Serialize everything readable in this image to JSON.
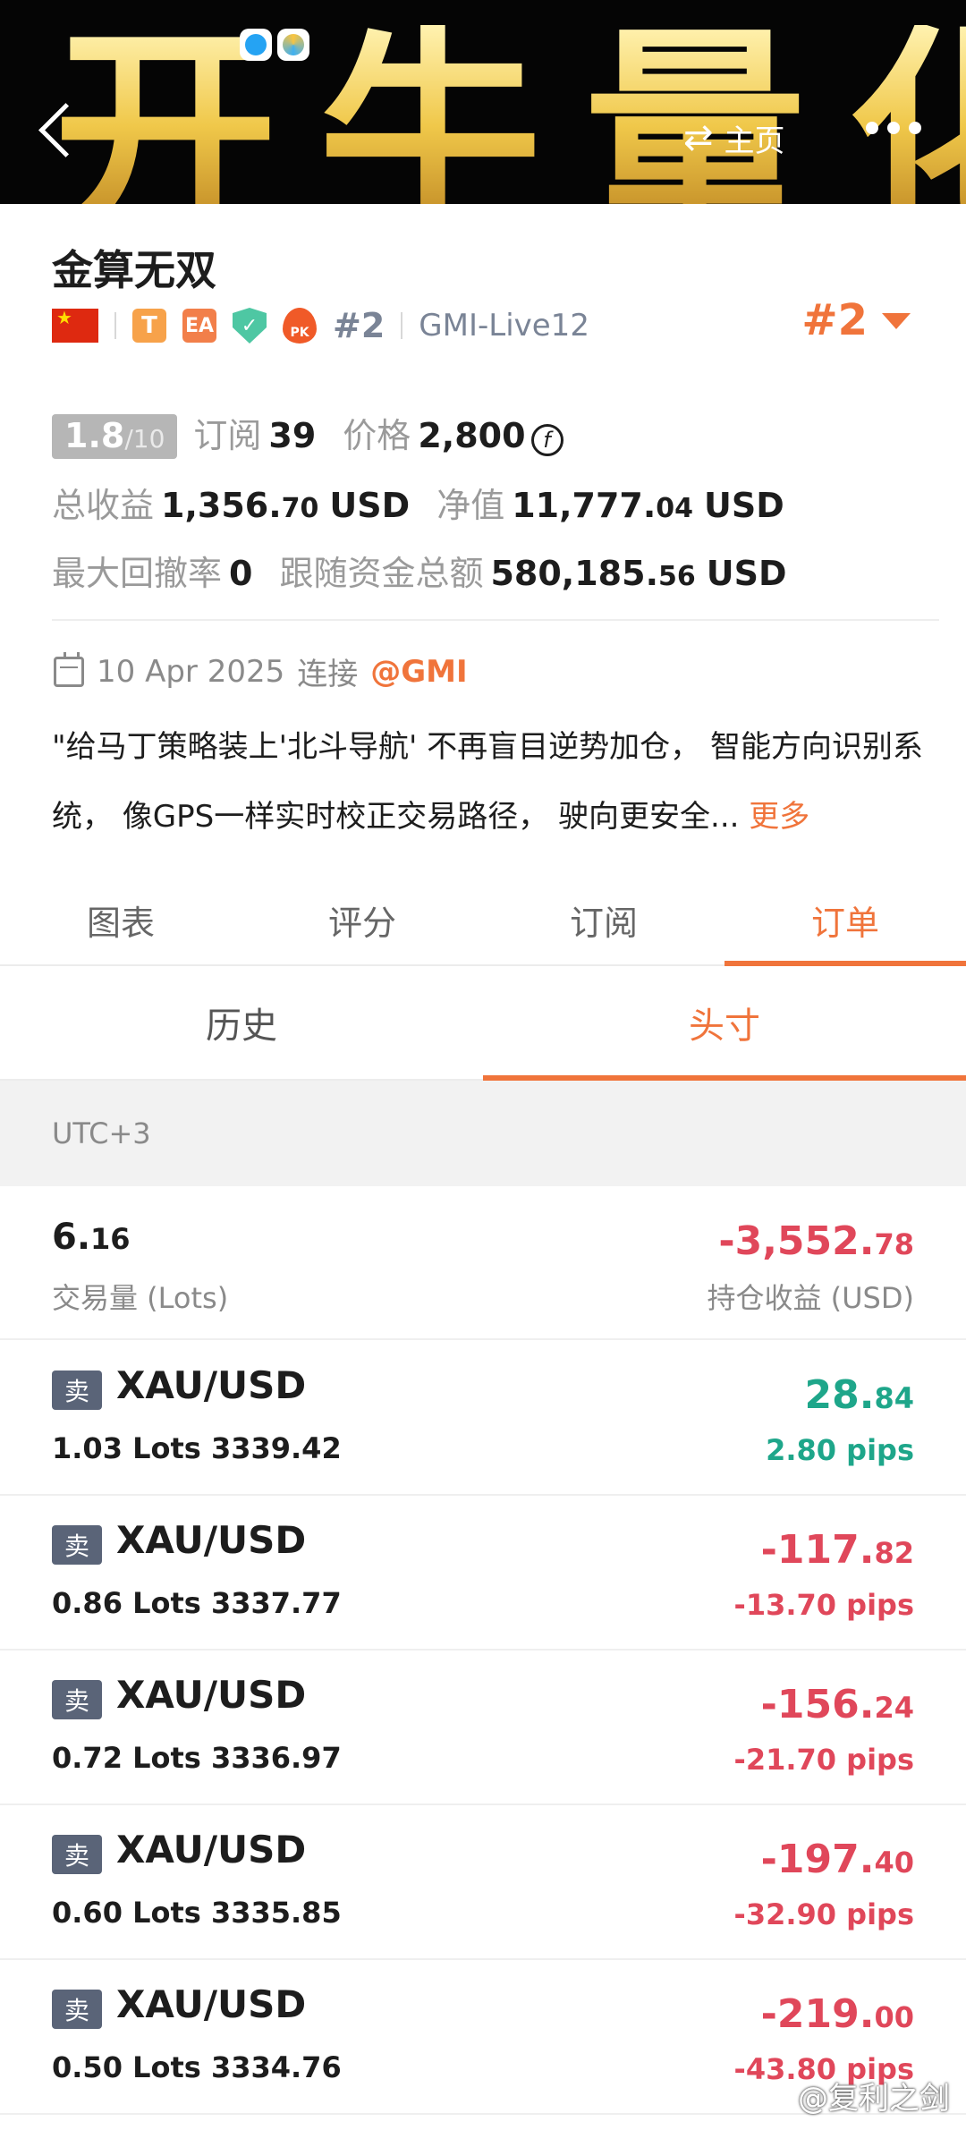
{
  "banner": {
    "text": "开牛量化",
    "home_label": "主页"
  },
  "header": {
    "title": "金算无双",
    "rank_small": "#2",
    "account": "GMI-Live12",
    "rank_big": "#2",
    "tag_t": "T",
    "tag_ea": "EA",
    "tag_pk": "PK"
  },
  "stats": {
    "score_main": "1.8",
    "score_den": "/10",
    "subscribe_label": "订阅",
    "subscribe_value": "39",
    "price_label": "价格",
    "price_value": "2,800",
    "total_profit_label": "总收益",
    "total_profit_int": "1,356.",
    "total_profit_dec": "70",
    "total_profit_unit": "USD",
    "equity_label": "净值",
    "equity_int": "11,777.",
    "equity_dec": "04",
    "equity_unit": "USD",
    "drawdown_label": "最大回撤率",
    "drawdown_value": "0",
    "follow_label": "跟随资金总额",
    "follow_int": "580,185.",
    "follow_dec": "56",
    "follow_unit": "USD"
  },
  "connect": {
    "date": "10 Apr 2025",
    "label": "连接",
    "handle": "@GMI"
  },
  "description": {
    "text": "\"给马丁策略装上'北斗导航' 不再盲目逆势加仓， 智能方向识别系统， 像GPS一样实时校正交易路径， 驶向更安全...",
    "more": "更多"
  },
  "tabs": [
    "图表",
    "评分",
    "订阅",
    "订单"
  ],
  "subtabs": [
    "历史",
    "头寸"
  ],
  "timezone": "UTC+3",
  "summary": {
    "volume_int": "6.",
    "volume_dec": "16",
    "volume_label": "交易量 (Lots)",
    "pnl_int": "-3,552.",
    "pnl_dec": "78",
    "pnl_label": "持仓收益 (USD)"
  },
  "orders": [
    {
      "side": "卖",
      "symbol": "XAU/USD",
      "detail": "1.03 Lots  3339.42",
      "pnl_int": "28.",
      "pnl_dec": "84",
      "pips": "2.80 pips",
      "sign": "pos"
    },
    {
      "side": "卖",
      "symbol": "XAU/USD",
      "detail": "0.86 Lots  3337.77",
      "pnl_int": "-117.",
      "pnl_dec": "82",
      "pips": "-13.70 pips",
      "sign": "neg"
    },
    {
      "side": "卖",
      "symbol": "XAU/USD",
      "detail": "0.72 Lots  3336.97",
      "pnl_int": "-156.",
      "pnl_dec": "24",
      "pips": "-21.70 pips",
      "sign": "neg"
    },
    {
      "side": "卖",
      "symbol": "XAU/USD",
      "detail": "0.60 Lots  3335.85",
      "pnl_int": "-197.",
      "pnl_dec": "40",
      "pips": "-32.90 pips",
      "sign": "neg"
    },
    {
      "side": "卖",
      "symbol": "XAU/USD",
      "detail": "0.50 Lots  3334.76",
      "pnl_int": "-219.",
      "pnl_dec": "00",
      "pips": "-43.80 pips",
      "sign": "neg"
    }
  ],
  "watermark": "@复利之剑",
  "colors": {
    "accent": "#f0743b",
    "positive": "#1ea68a",
    "negative": "#e0475a",
    "badge_bg": "#5a6478"
  }
}
